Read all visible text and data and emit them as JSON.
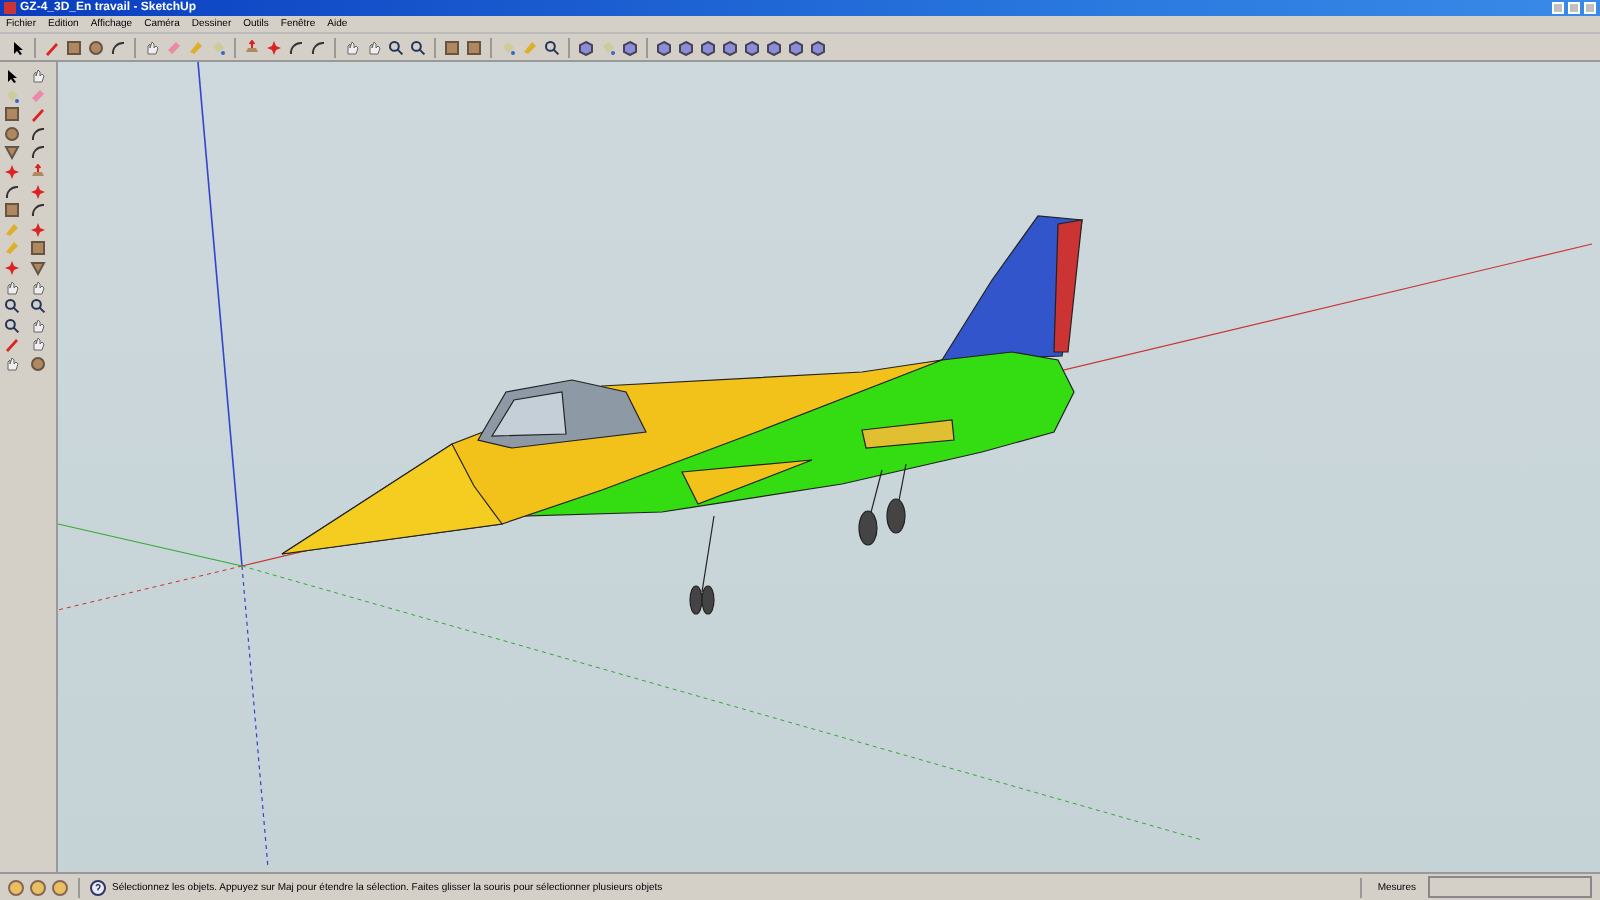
{
  "window": {
    "title": "GZ-4_3D_En travail - SketchUp"
  },
  "menu": [
    "Fichier",
    "Edition",
    "Affichage",
    "Caméra",
    "Dessiner",
    "Outils",
    "Fenêtre",
    "Aide"
  ],
  "status_bar": {
    "message": "Sélectionnez les objets. Appuyez sur Maj pour étendre la sélection. Faites glisser la souris pour sélectionner plusieurs objets",
    "measure_label": "Mesures"
  }
}
